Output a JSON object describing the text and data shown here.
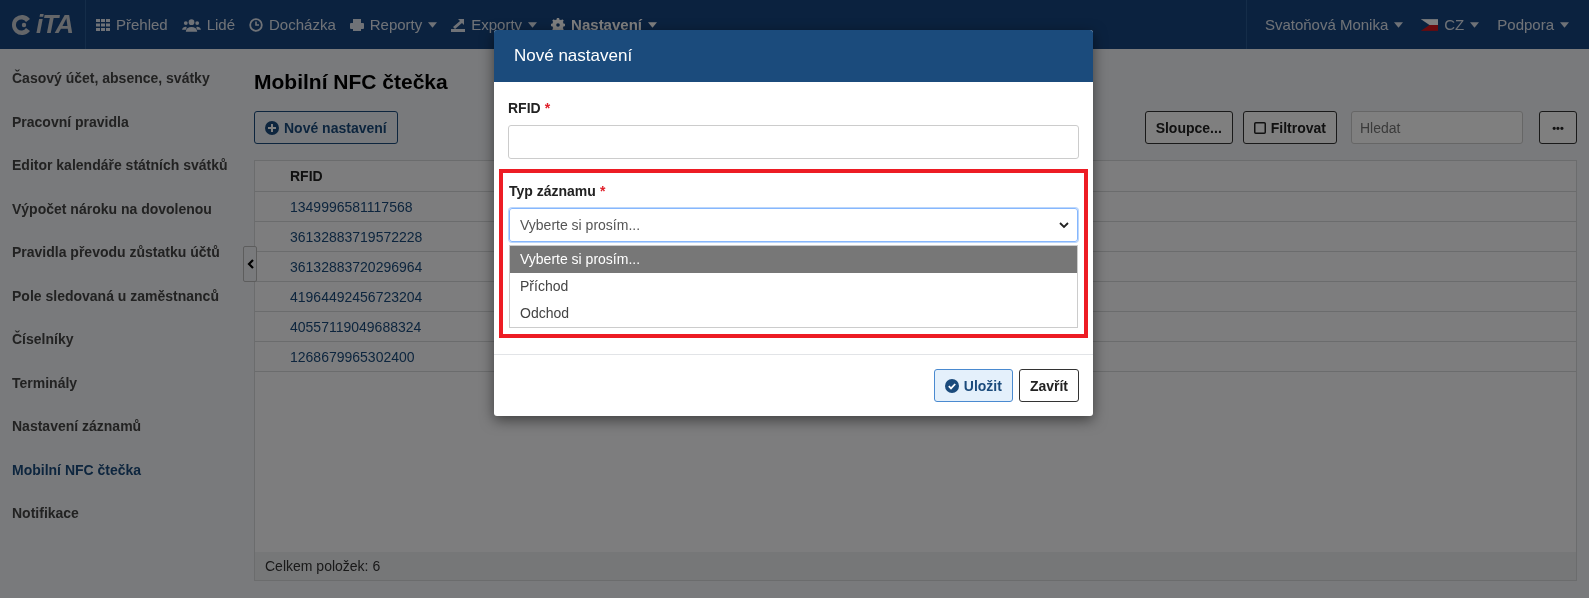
{
  "navbar": {
    "logo": "iTA",
    "items": [
      {
        "label": "Přehled",
        "dropdown": false,
        "selected": false
      },
      {
        "label": "Lidé",
        "dropdown": false,
        "selected": false
      },
      {
        "label": "Docházka",
        "dropdown": false,
        "selected": false
      },
      {
        "label": "Reporty",
        "dropdown": true,
        "selected": false
      },
      {
        "label": "Exporty",
        "dropdown": true,
        "selected": false
      },
      {
        "label": "Nastavení",
        "dropdown": true,
        "selected": true
      }
    ],
    "right": [
      {
        "label": "Svatoňová Monika",
        "dropdown": true
      },
      {
        "label": "CZ",
        "dropdown": true
      },
      {
        "label": "Podpora",
        "dropdown": true
      }
    ]
  },
  "sidebar": {
    "items": [
      {
        "label": "Časový účet, absence, svátky",
        "selected": false
      },
      {
        "label": "Pracovní pravidla",
        "selected": false
      },
      {
        "label": "Editor kalendáře státních svátků",
        "selected": false
      },
      {
        "label": "Výpočet nároku na dovolenou",
        "selected": false
      },
      {
        "label": "Pravidla převodu zůstatku účtů",
        "selected": false
      },
      {
        "label": "Pole sledovaná u zaměstnanců",
        "selected": false
      },
      {
        "label": "Číselníky",
        "selected": false
      },
      {
        "label": "Terminály",
        "selected": false
      },
      {
        "label": "Nastavení záznamů",
        "selected": false
      },
      {
        "label": "Mobilní NFC čtečka",
        "selected": true
      },
      {
        "label": "Notifikace",
        "selected": false
      }
    ]
  },
  "page": {
    "title": "Mobilní NFC čtečka",
    "new_button": "Nové nastavení",
    "columns_button": "Sloupce...",
    "filter": {
      "label": "Filtrovat",
      "checked": false
    },
    "search": {
      "placeholder": "Hledat"
    },
    "more_button": "•••",
    "table": {
      "columns": [
        "RFID"
      ],
      "rows": [
        [
          "1349996581117568"
        ],
        [
          "36132883719572228"
        ],
        [
          "36132883720296964"
        ],
        [
          "41964492456723204"
        ],
        [
          "40557119049688324"
        ],
        [
          "1268679965302400"
        ]
      ]
    },
    "total": "Celkem položek: 6"
  },
  "dialog": {
    "title": "Nové nastavení",
    "required_mark": "*",
    "fields": [
      {
        "label": "RFID",
        "required": true,
        "kind": "text",
        "highlighted": false
      },
      {
        "label": "Typ záznamu",
        "required": true,
        "kind": "select",
        "highlighted": true,
        "value": "Vyberte si prosím...",
        "expanded": true,
        "options": [
          {
            "label": "Vyberte si prosím...",
            "selected": true
          },
          {
            "label": "Příchod",
            "selected": false
          },
          {
            "label": "Odchod",
            "selected": false
          }
        ]
      }
    ],
    "save_button": "Uložit",
    "close_button": "Zavřít"
  }
}
